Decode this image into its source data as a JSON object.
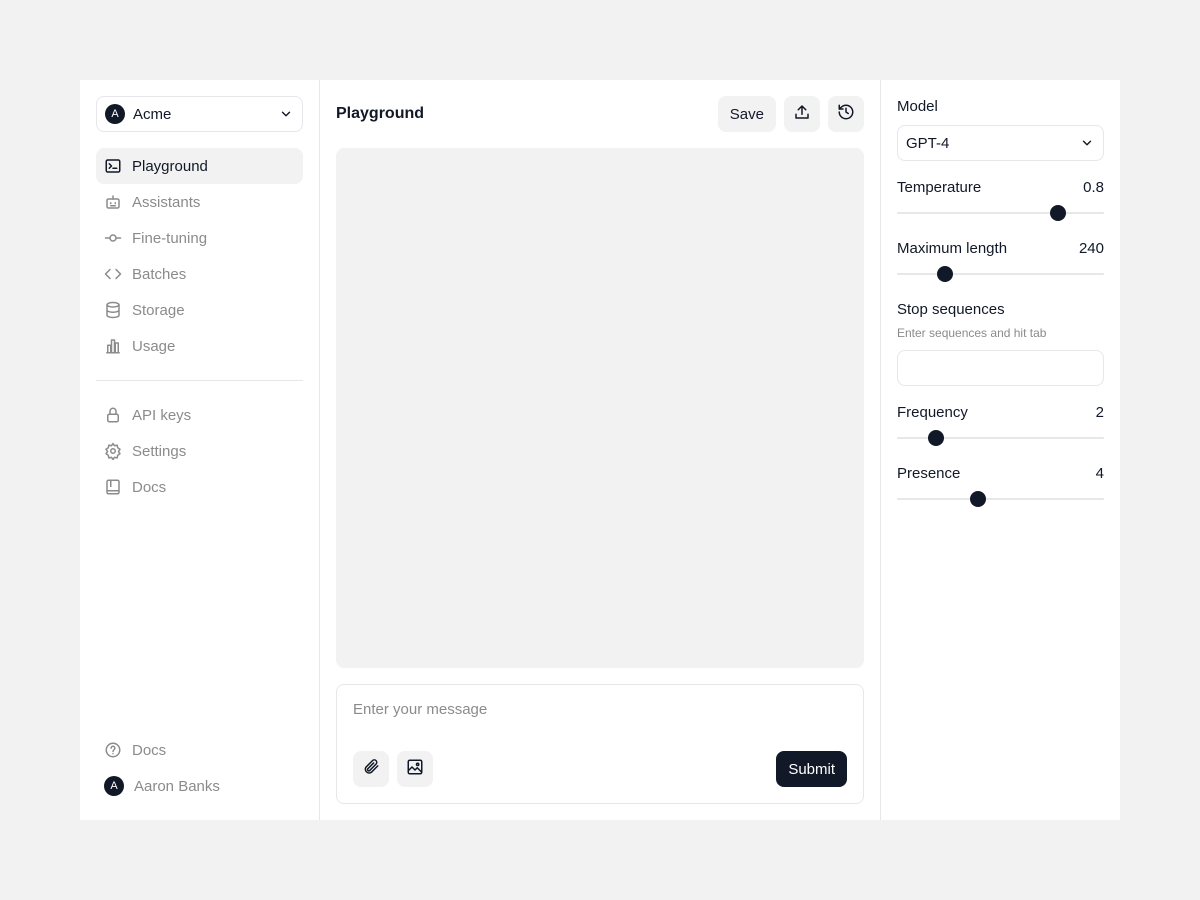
{
  "org": {
    "avatar_letter": "A",
    "name": "Acme"
  },
  "nav": {
    "items": [
      {
        "label": "Playground",
        "icon": "terminal-icon"
      },
      {
        "label": "Assistants",
        "icon": "bot-icon"
      },
      {
        "label": "Fine-tuning",
        "icon": "commit-icon"
      },
      {
        "label": "Batches",
        "icon": "code-icon"
      },
      {
        "label": "Storage",
        "icon": "database-icon"
      },
      {
        "label": "Usage",
        "icon": "bar-chart-icon"
      }
    ],
    "secondary": [
      {
        "label": "API keys",
        "icon": "lock-icon"
      },
      {
        "label": "Settings",
        "icon": "gear-icon"
      },
      {
        "label": "Docs",
        "icon": "book-icon"
      }
    ]
  },
  "footer": {
    "help_label": "Docs",
    "user_avatar_letter": "A",
    "user_name": "Aaron Banks"
  },
  "main": {
    "title": "Playground",
    "save_label": "Save",
    "composer_placeholder": "Enter your message",
    "submit_label": "Submit"
  },
  "settings": {
    "model_label": "Model",
    "model_value": "GPT-4",
    "temperature": {
      "label": "Temperature",
      "value": "0.8",
      "fraction": 0.78
    },
    "max_length": {
      "label": "Maximum length",
      "value": "240",
      "fraction": 0.23
    },
    "stop_sequences": {
      "label": "Stop sequences",
      "helper": "Enter sequences and hit tab"
    },
    "frequency": {
      "label": "Frequency",
      "value": "2",
      "fraction": 0.19
    },
    "presence": {
      "label": "Presence",
      "value": "4",
      "fraction": 0.39
    }
  },
  "colors": {
    "accent": "#111827",
    "muted": "#8b8b8b",
    "surface": "#f2f2f2",
    "border": "#e5e7eb"
  }
}
